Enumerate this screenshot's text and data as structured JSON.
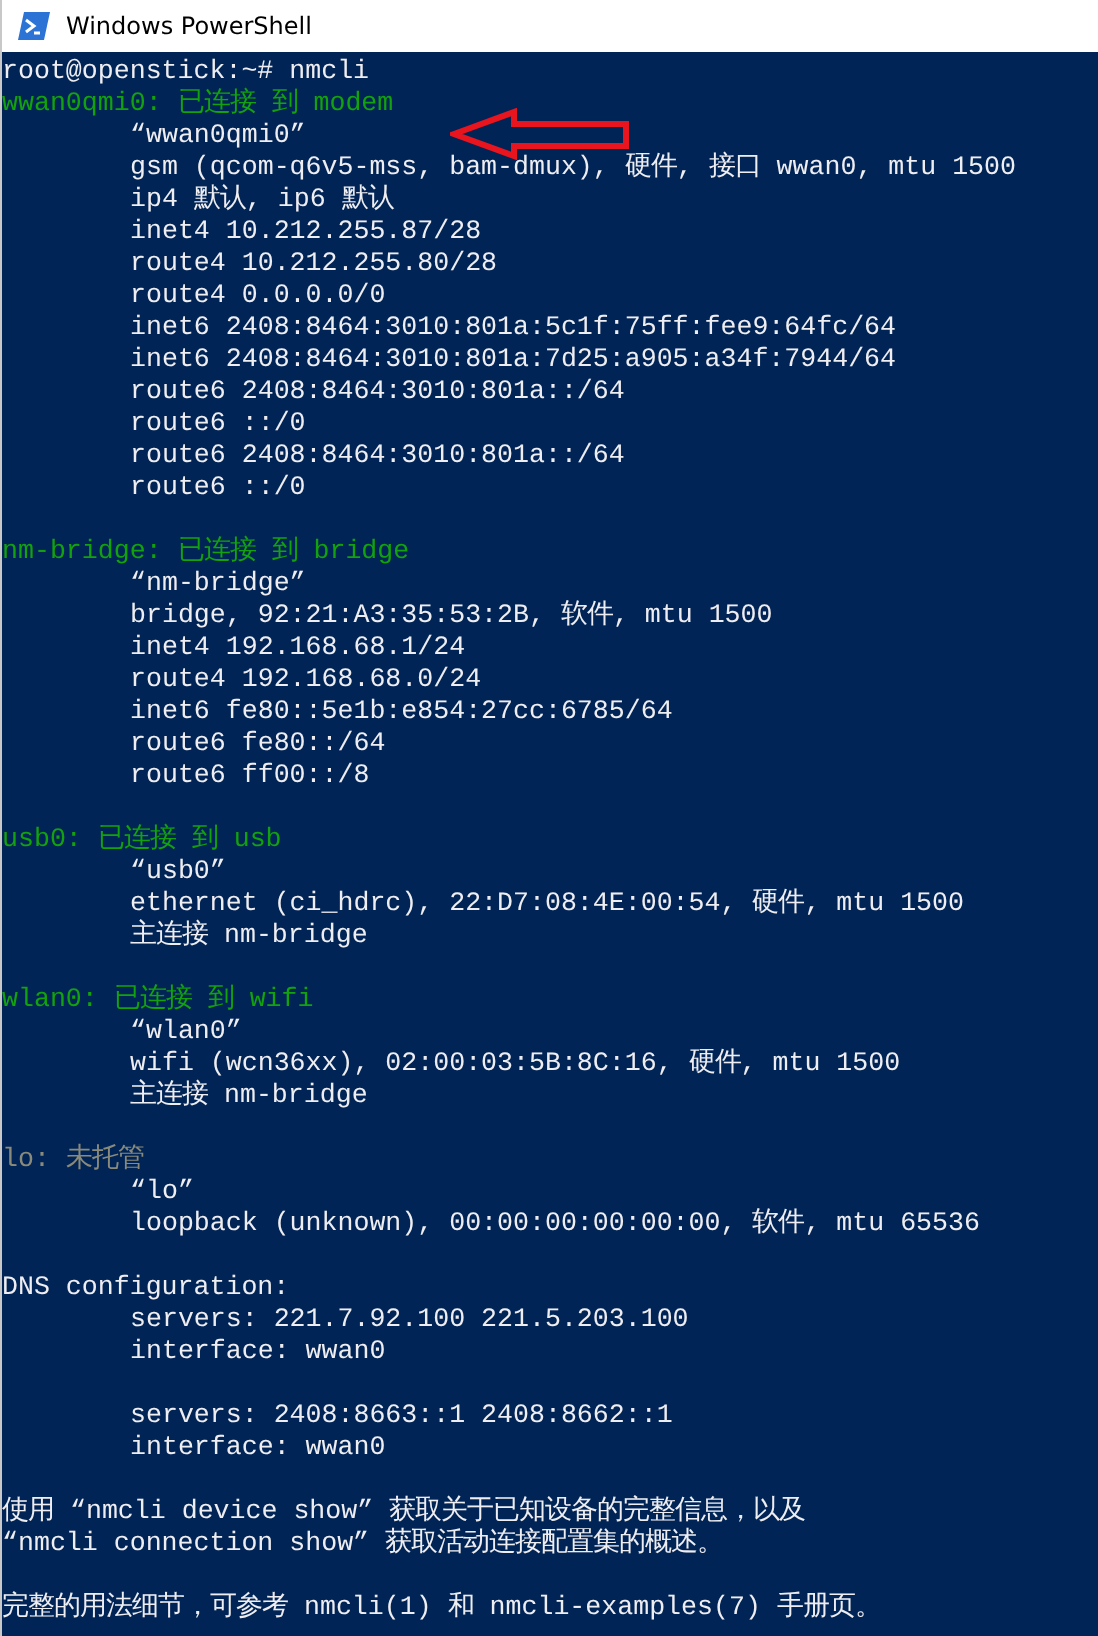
{
  "window": {
    "title": "Windows PowerShell"
  },
  "prompt": "root@openstick:~# nmcli",
  "devices": [
    {
      "header": "wwan0qmi0: 已连接 到 modem",
      "kind": "connected",
      "annotated": true,
      "details": [
        "“wwan0qmi0”",
        "gsm (qcom-q6v5-mss, bam-dmux), 硬件, 接口 wwan0, mtu 1500",
        "ip4 默认, ip6 默认",
        "inet4 10.212.255.87/28",
        "route4 10.212.255.80/28",
        "route4 0.0.0.0/0",
        "inet6 2408:8464:3010:801a:5c1f:75ff:fee9:64fc/64",
        "inet6 2408:8464:3010:801a:7d25:a905:a34f:7944/64",
        "route6 2408:8464:3010:801a::/64",
        "route6 ::/0",
        "route6 2408:8464:3010:801a::/64",
        "route6 ::/0"
      ]
    },
    {
      "header": "nm-bridge: 已连接 到 bridge",
      "kind": "connected",
      "annotated": false,
      "details": [
        "“nm-bridge”",
        "bridge, 92:21:A3:35:53:2B, 软件, mtu 1500",
        "inet4 192.168.68.1/24",
        "route4 192.168.68.0/24",
        "inet6 fe80::5e1b:e854:27cc:6785/64",
        "route6 fe80::/64",
        "route6 ff00::/8"
      ]
    },
    {
      "header": "usb0: 已连接 到 usb",
      "kind": "connected",
      "annotated": false,
      "details": [
        "“usb0”",
        "ethernet (ci_hdrc), 22:D7:08:4E:00:54, 硬件, mtu 1500",
        "主连接 nm-bridge"
      ]
    },
    {
      "header": "wlan0: 已连接 到 wifi",
      "kind": "connected",
      "annotated": false,
      "details": [
        "“wlan0”",
        "wifi (wcn36xx), 02:00:03:5B:8C:16, 硬件, mtu 1500",
        "主连接 nm-bridge"
      ]
    },
    {
      "header": "lo: 未托管",
      "kind": "unmanaged",
      "annotated": false,
      "details": [
        "“lo”",
        "loopback (unknown), 00:00:00:00:00:00, 软件, mtu 65536"
      ]
    }
  ],
  "dns": {
    "title": "DNS configuration:",
    "groups": [
      {
        "lines": [
          "servers: 221.7.92.100 221.5.203.100",
          "interface: wwan0"
        ]
      },
      {
        "lines": [
          "servers: 2408:8663::1 2408:8662::1",
          "interface: wwan0"
        ]
      }
    ]
  },
  "hint": [
    "使用 “nmcli device show” 获取关于已知设备的完整信息，以及",
    "“nmcli connection show” 获取活动连接配置集的概述。"
  ],
  "usage": "完整的用法细节，可参考 nmcli(1) 和 nmcli-examples(7) 手册页。"
}
